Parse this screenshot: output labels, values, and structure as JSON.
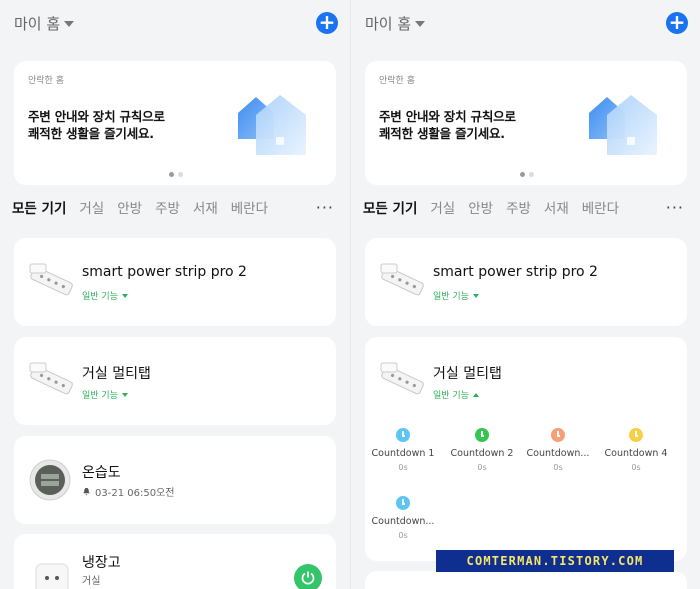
{
  "home": {
    "name": "마이 홈"
  },
  "banner": {
    "small": "안락한 홈",
    "line1": "주변 안내와 장치 규칙으로",
    "line2": "쾌적한 생활을 즐기세요."
  },
  "tabs": [
    "모든 기기",
    "거실",
    "안방",
    "주방",
    "서재",
    "베란다"
  ],
  "tab_more": "···",
  "devices": {
    "strip": {
      "name": "smart power strip pro 2",
      "sub": "일반 기능"
    },
    "multitap": {
      "name": "거실 멀티탭",
      "sub": "일반 기능"
    },
    "thermo": {
      "name": "온습도",
      "meta": "03-21 06:50오전"
    },
    "fridge": {
      "name": "냉장고",
      "meta": "거실"
    }
  },
  "countdowns": [
    {
      "label": "Countdown 1",
      "value": "0s",
      "color": "#5cc6f2"
    },
    {
      "label": "Countdown 2",
      "value": "0s",
      "color": "#35c552"
    },
    {
      "label": "Countdown...",
      "value": "0s",
      "color": "#f5a07a"
    },
    {
      "label": "Countdown 4",
      "value": "0s",
      "color": "#f7cf47"
    },
    {
      "label": "Countdown...",
      "value": "0s",
      "color": "#5cc6f2"
    }
  ],
  "watermark": "COMTERMAN.TISTORY.COM",
  "colors": {
    "accent": "#1a73f0",
    "green": "#2bb15a",
    "background": "#f3f4f6"
  }
}
